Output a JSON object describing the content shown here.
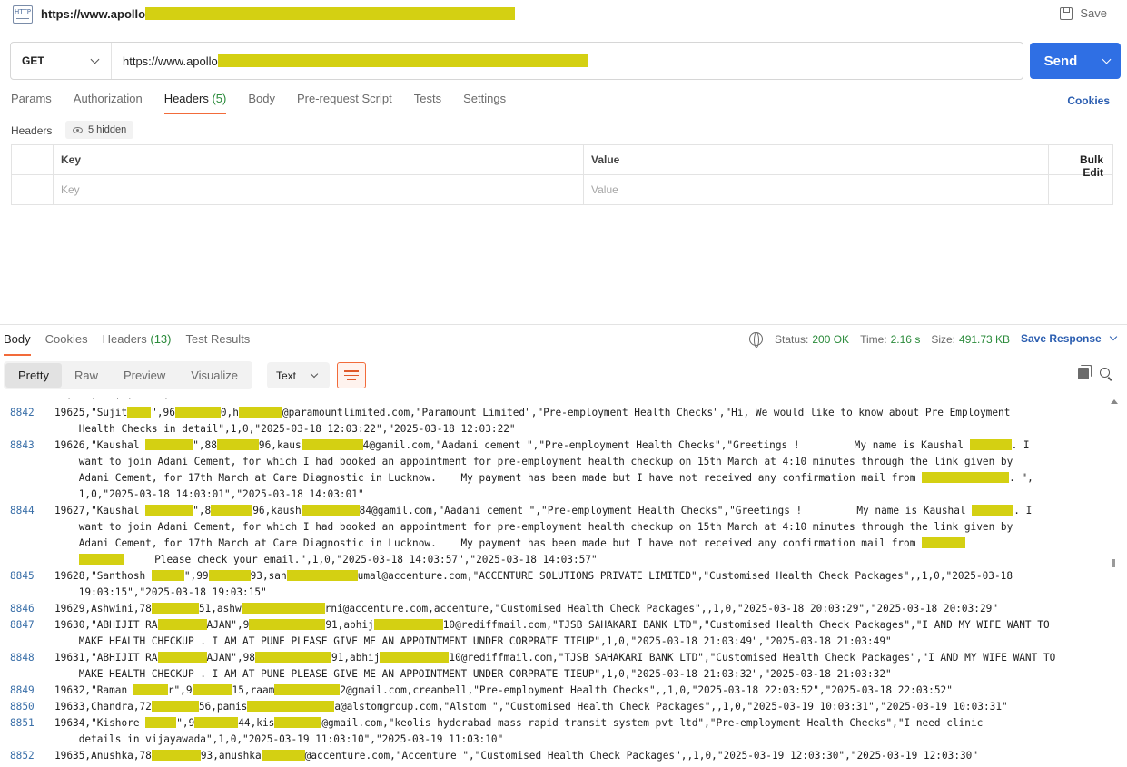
{
  "top": {
    "title": "https://www.apollo",
    "save_label": "Save"
  },
  "request": {
    "method": "GET",
    "url": "https://www.apollo",
    "send_label": "Send",
    "tabs": [
      {
        "label": "Params",
        "count": ""
      },
      {
        "label": "Authorization",
        "count": ""
      },
      {
        "label": "Headers",
        "count": "(5)"
      },
      {
        "label": "Body",
        "count": ""
      },
      {
        "label": "Pre-request Script",
        "count": ""
      },
      {
        "label": "Tests",
        "count": ""
      },
      {
        "label": "Settings",
        "count": ""
      }
    ],
    "cookies_label": "Cookies",
    "headers_label": "Headers",
    "hidden_label": "5 hidden",
    "table": {
      "col_key": "Key",
      "col_value": "Value",
      "bulk_edit": "Bulk Edit",
      "placeholder_key": "Key",
      "placeholder_value": "Value"
    }
  },
  "response": {
    "tabs": [
      {
        "label": "Body",
        "count": ""
      },
      {
        "label": "Cookies",
        "count": ""
      },
      {
        "label": "Headers",
        "count": "(13)"
      },
      {
        "label": "Test Results",
        "count": ""
      }
    ],
    "status_label": "Status:",
    "status_value": "200 OK",
    "time_label": "Time:",
    "time_value": "2.16 s",
    "size_label": "Size:",
    "size_value": "491.73 KB",
    "save_response": "Save Response",
    "views": [
      "Pretty",
      "Raw",
      "Preview",
      "Visualize"
    ],
    "format": "Text",
    "top_fragment": "' , ' , ' , , ' ' ,",
    "lines": [
      {
        "n": "8842",
        "rows": [
          [
            "19625,\"Sujit",
            "",
            "\",96",
            "",
            "0,h",
            "",
            "@paramountlimited.com,\"Paramount Limited\",\"Pre-employment Health Checks\",\"Hi, We would like to know about Pre Employment"
          ],
          [
            "    Health Checks in detail\",1,0,\"2025-03-18 12:03:22\",\"2025-03-18 12:03:22\""
          ]
        ]
      },
      {
        "n": "8843",
        "rows": [
          [
            "19626,\"Kaushal ",
            "",
            "\",88",
            "",
            "96,kaus",
            "",
            "4@gamil.com,\"Aadani cement \",\"Pre-employment Health Checks\",\"Greetings !         My name is Kaushal ",
            "",
            ". I"
          ],
          [
            "    want to join Adani Cement, for which I had booked an appointment for pre-employment health checkup on 15th March at 4:10 minutes through the link given by"
          ],
          [
            "    Adani Cement, for 17th March at Care Diagnostic in Lucknow.    My payment has been made but I have not received any confirmation mail from ",
            "",
            ". \","
          ],
          [
            "    1,0,\"2025-03-18 14:03:01\",\"2025-03-18 14:03:01\""
          ]
        ]
      },
      {
        "n": "8844",
        "rows": [
          [
            "19627,\"Kaushal ",
            "",
            "\",8",
            "",
            "96,kaush",
            "",
            "84@gamil.com,\"Aadani cement \",\"Pre-employment Health Checks\",\"Greetings !         My name is Kaushal ",
            "",
            ". I"
          ],
          [
            "    want to join Adani Cement, for which I had booked an appointment for pre-employment health checkup on 15th March at 4:10 minutes through the link given by"
          ],
          [
            "    Adani Cement, for 17th March at Care Diagnostic in Lucknow.    My payment has been made but I have not received any confirmation mail from ",
            ""
          ],
          [
            "    ",
            "",
            "     Please check your email.\",1,0,\"2025-03-18 14:03:57\",\"2025-03-18 14:03:57\""
          ]
        ]
      },
      {
        "n": "8845",
        "rows": [
          [
            "19628,\"Santhosh ",
            "",
            "\",99",
            "",
            "93,san",
            "",
            "umal@accenture.com,\"ACCENTURE SOLUTIONS PRIVATE LIMITED\",\"Customised Health Check Packages\",,1,0,\"2025-03-18"
          ],
          [
            "    19:03:15\",\"2025-03-18 19:03:15\""
          ]
        ]
      },
      {
        "n": "8846",
        "rows": [
          [
            "19629,Ashwini,78",
            "",
            "51,ashw",
            "",
            "rni@accenture.com,accenture,\"Customised Health Check Packages\",,1,0,\"2025-03-18 20:03:29\",\"2025-03-18 20:03:29\""
          ]
        ]
      },
      {
        "n": "8847",
        "rows": [
          [
            "19630,\"ABHIJIT RA",
            "",
            "AJAN\",9",
            "",
            "91,abhij",
            "",
            "10@rediffmail.com,\"TJSB SAHAKARI BANK LTD\",\"Customised Health Check Packages\",\"I AND MY WIFE WANT TO"
          ],
          [
            "    MAKE HEALTH CHECKUP . I AM AT PUNE PLEASE GIVE ME AN APPOINTMENT UNDER CORPRATE TIEUP\",1,0,\"2025-03-18 21:03:49\",\"2025-03-18 21:03:49\""
          ]
        ]
      },
      {
        "n": "8848",
        "rows": [
          [
            "19631,\"ABHIJIT RA",
            "",
            "AJAN\",98",
            "",
            "91,abhij",
            "",
            "10@rediffmail.com,\"TJSB SAHAKARI BANK LTD\",\"Customised Health Check Packages\",\"I AND MY WIFE WANT TO"
          ],
          [
            "    MAKE HEALTH CHECKUP . I AM AT PUNE PLEASE GIVE ME AN APPOINTMENT UNDER CORPRATE TIEUP\",1,0,\"2025-03-18 21:03:32\",\"2025-03-18 21:03:32\""
          ]
        ]
      },
      {
        "n": "8849",
        "rows": [
          [
            "19632,\"Raman ",
            "",
            "r\",9",
            "",
            "15,raam",
            "",
            "2@gmail.com,creambell,\"Pre-employment Health Checks\",,1,0,\"2025-03-18 22:03:52\",\"2025-03-18 22:03:52\""
          ]
        ]
      },
      {
        "n": "8850",
        "rows": [
          [
            "19633,Chandra,72",
            "",
            "56,pamis",
            "",
            "a@alstomgroup.com,\"Alstom \",\"Customised Health Check Packages\",,1,0,\"2025-03-19 10:03:31\",\"2025-03-19 10:03:31\""
          ]
        ]
      },
      {
        "n": "8851",
        "rows": [
          [
            "19634,\"Kishore ",
            "",
            "\",9",
            "",
            "44,kis",
            "",
            "@gmail.com,\"keolis hyderabad mass rapid transit system pvt ltd\",\"Pre-employment Health Checks\",\"I need clinic"
          ],
          [
            "    details in vijayawada\",1,0,\"2025-03-19 11:03:10\",\"2025-03-19 11:03:10\""
          ]
        ]
      },
      {
        "n": "8852",
        "rows": [
          [
            "19635,Anushka,78",
            "",
            "93,anushka",
            "",
            "@accenture.com,\"Accenture \",\"Customised Health Check Packages\",,1,0,\"2025-03-19 12:03:30\",\"2025-03-19 12:03:30\""
          ]
        ]
      }
    ]
  }
}
